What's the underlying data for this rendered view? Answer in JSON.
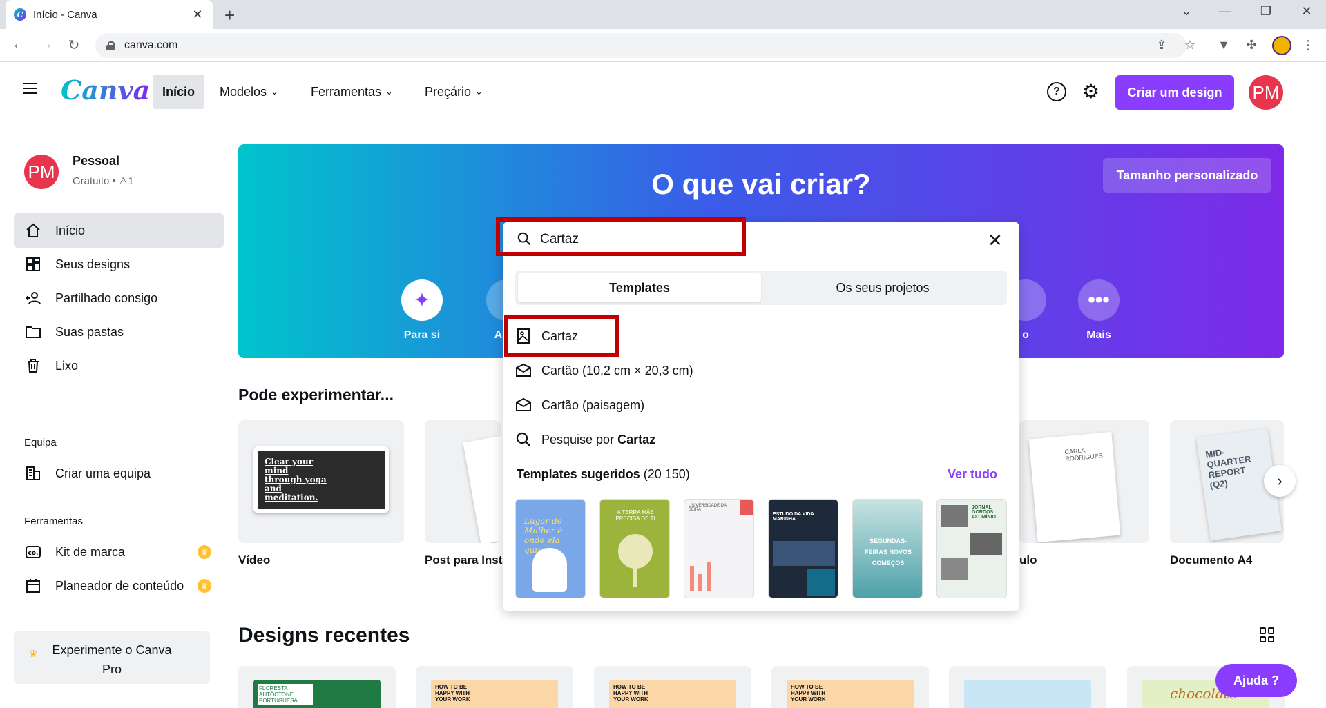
{
  "browser": {
    "tab_title": "Início - Canva",
    "url": "canva.com",
    "new_tab": "+",
    "close_tab": "✕"
  },
  "header": {
    "logo": "Canva",
    "nav": [
      {
        "label": "Início",
        "active": true
      },
      {
        "label": "Modelos",
        "dropdown": true
      },
      {
        "label": "Ferramentas",
        "dropdown": true
      },
      {
        "label": "Preçário",
        "dropdown": true
      }
    ],
    "help_icon": "question-icon",
    "settings_icon": "gear-icon",
    "create_button": "Criar um design",
    "avatar_initials": "PM",
    "accent_color": "#8b3dff",
    "avatar_color": "#e8344c"
  },
  "sidebar": {
    "account": {
      "initials": "PM",
      "name": "Pessoal",
      "plan": "Gratuito",
      "members": "1"
    },
    "items": [
      {
        "label": "Início",
        "icon": "home-icon",
        "active": true
      },
      {
        "label": "Seus designs",
        "icon": "grid-icon"
      },
      {
        "label": "Partilhado consigo",
        "icon": "users-icon"
      },
      {
        "label": "Suas pastas",
        "icon": "folder-icon"
      },
      {
        "label": "Lixo",
        "icon": "trash-icon"
      }
    ],
    "team_section": "Equipa",
    "team_item": "Criar uma equipa",
    "tools_section": "Ferramentas",
    "tools": [
      {
        "label": "Kit de marca",
        "icon": "brand-kit-icon",
        "pro": true
      },
      {
        "label": "Planeador de conteúdo",
        "icon": "calendar-icon",
        "pro": true
      }
    ],
    "pro_cta": "Experimente o Canva Pro"
  },
  "hero": {
    "title": "O que vai criar?",
    "custom_size": "Tamanho personalizado",
    "categories": [
      {
        "label": "Para si",
        "icon": "sparkle-icon"
      },
      {
        "label": "Apre"
      },
      {
        "label": "o"
      },
      {
        "label": "Mais",
        "icon": "more-icon"
      }
    ]
  },
  "search": {
    "query": "Cartaz",
    "tabs": [
      "Templates",
      "Os seus projetos"
    ],
    "active_tab": "Templates",
    "suggestions": [
      {
        "label": "Cartaz",
        "icon": "poster-icon"
      },
      {
        "label": "Cartão (10,2 cm × 20,3 cm)",
        "icon": "card-icon"
      },
      {
        "label": "Cartão (paisagem)",
        "icon": "card-icon"
      }
    ],
    "search_for_prefix": "Pesquise por",
    "search_for_term": "Cartaz",
    "suggested_templates_label": "Templates sugeridos",
    "suggested_templates_count": "(20 150)",
    "see_all": "Ver tudo",
    "templates": [
      {
        "bg": "#7aa7e8",
        "text": "Lugar de Mulher é onde ela quiser"
      },
      {
        "bg": "#9cb43c",
        "text": "A TERRA MÃE PRECISA DE TI"
      },
      {
        "bg": "#f4f4f6",
        "text": "UNIVERSIDADE DA BEIRA"
      },
      {
        "bg": "#1e2a3a",
        "text": "ESTUDO DA VIDA MARINHA"
      },
      {
        "bg": "#5fb3b8",
        "text": "SEGUNDAS-FEIRAS NOVOS COMEÇOS"
      },
      {
        "bg": "#e9f1ea",
        "text": "JORNAL GORDOS ALOMÍNIO"
      }
    ],
    "highlight_color": "#c00000"
  },
  "try_section": {
    "title": "Pode experimentar...",
    "cards": [
      {
        "label": "Vídeo",
        "thumb_text": "Clear your mind through yoga and meditation."
      },
      {
        "label": "Post para Inst"
      },
      {
        "label": "ulo",
        "thumb_text": "CARLA RODRIGUES"
      },
      {
        "label": "Documento A4",
        "thumb_text": "MID-QUARTER REPORT (Q2)"
      }
    ]
  },
  "recent": {
    "title": "Designs recentes",
    "cards": [
      {
        "text": "FLORESTA AUTÓCTONE PORTUGUESA"
      },
      {
        "text": "HOW TO BE HAPPY WITH YOUR WORK"
      },
      {
        "text": "HOW TO BE HAPPY WITH YOUR WORK"
      },
      {
        "text": "HOW TO BE HAPPY WITH YOUR WORK"
      },
      {
        "text": ""
      },
      {
        "text": "chocolate"
      }
    ]
  },
  "help_button": "Ajuda ?"
}
